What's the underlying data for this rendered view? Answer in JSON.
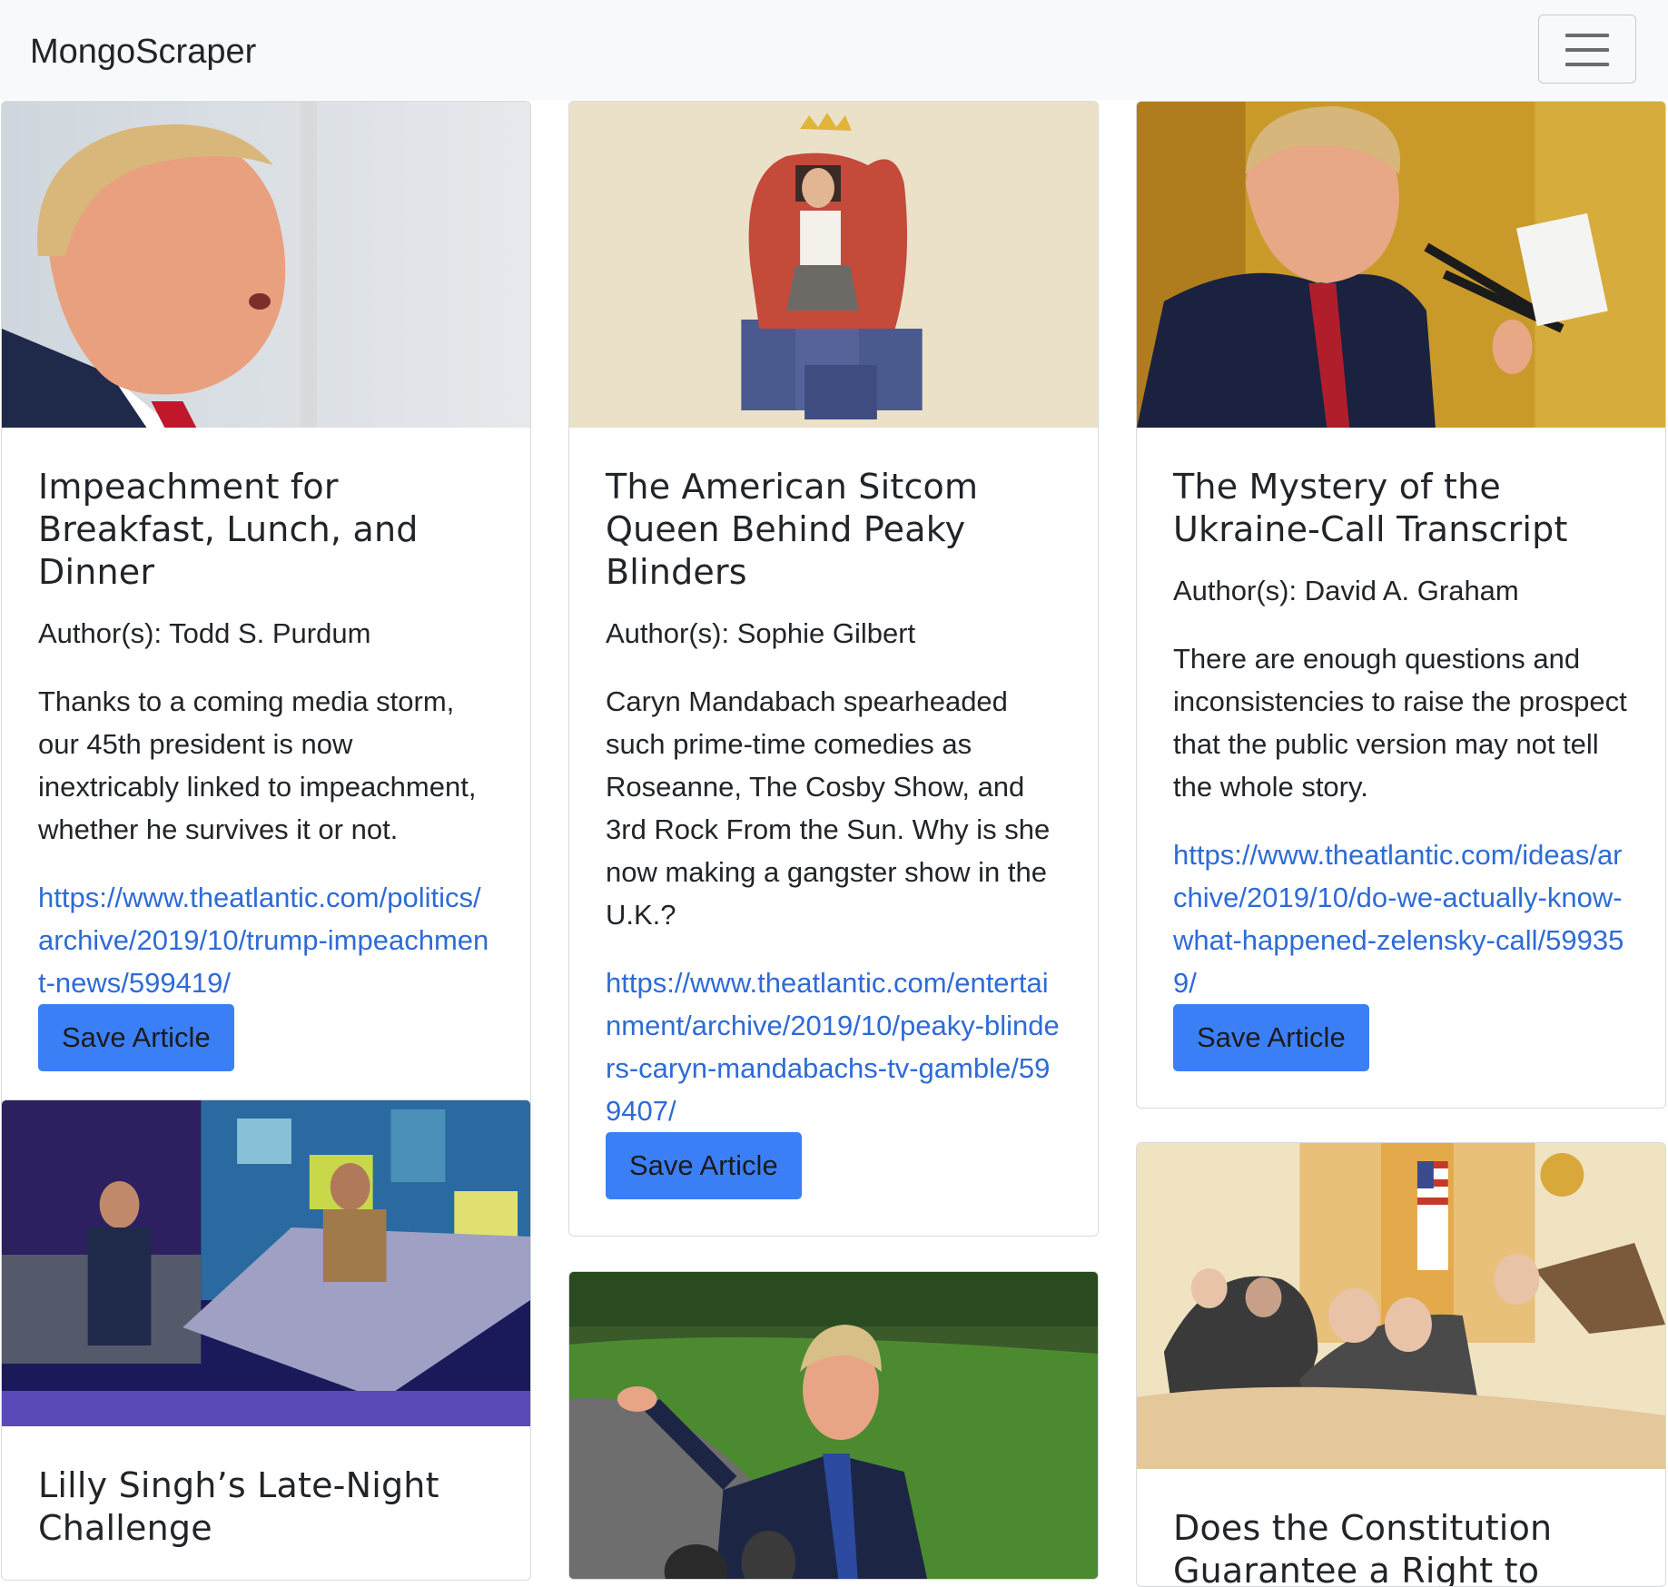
{
  "navbar": {
    "brand": "MongoScraper",
    "toggler_icon": "hamburger-menu-icon"
  },
  "articles": [
    {
      "title": "Impeachment for Breakfast, Lunch, and Dinner",
      "author": "Author(s): Todd S. Purdum",
      "summary": "Thanks to a coming media storm, our 45th president is now inextricably linked to impeachment, whether he survives it or not.",
      "link": "https://www.theatlantic.com/politics/archive/2019/10/trump-impeachment-news/599419/",
      "button": "Save Article"
    },
    {
      "title": "The American Sitcom Queen Behind Peaky Blinders",
      "author": "Author(s): Sophie Gilbert",
      "summary": "Caryn Mandabach spearheaded such prime-time comedies as Roseanne, The Cosby Show, and 3rd Rock From the Sun. Why is she now making a gangster show in the U.K.?",
      "link": "https://www.theatlantic.com/entertainment/archive/2019/10/peaky-blinders-caryn-mandabachs-tv-gamble/599407/",
      "button": "Save Article"
    },
    {
      "title": "The Mystery of the Ukraine-Call Transcript",
      "author": "Author(s): David A. Graham",
      "summary": "There are enough questions and inconsistencies to raise the prospect that the public version may not tell the whole story.",
      "link": "https://www.theatlantic.com/ideas/archive/2019/10/do-we-actually-know-what-happened-zelensky-call/599359/",
      "button": "Save Article"
    },
    {
      "title": "Lilly Singh’s Late-Night Challenge"
    },
    {
      "title": "Does the Constitution Guarantee a Right to"
    }
  ],
  "colors": {
    "navbar_bg": "#f8f9fa",
    "link": "#2e6bd6",
    "button_bg": "#3b7ff6"
  }
}
